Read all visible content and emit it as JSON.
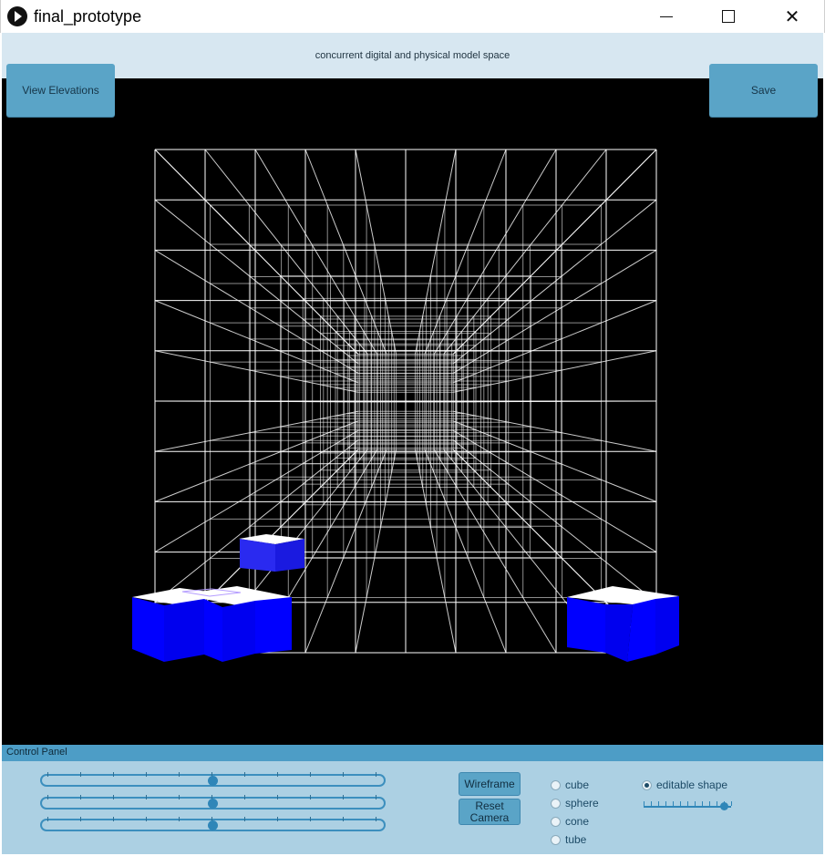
{
  "window": {
    "title": "final_prototype",
    "close_glyph": "✕"
  },
  "header": {
    "subtitle": "concurrent digital and physical model space"
  },
  "toolbar": {
    "view_elevations_label": "View Elevations",
    "save_label": "Save"
  },
  "control_panel": {
    "title": "Control Panel",
    "sliders": [
      {
        "value": 0.5
      },
      {
        "value": 0.5
      },
      {
        "value": 0.5
      }
    ],
    "wireframe_label": "Wireframe",
    "reset_camera_label": "Reset Camera",
    "shape_options": [
      "cube",
      "sphere",
      "cone",
      "tube"
    ],
    "selected_shape": "",
    "editable_shape_label": "editable shape",
    "editable_shape_checked": true,
    "editable_slider_value": 0.96
  },
  "colors": {
    "accent": "#5aa4c7",
    "panel": "#acd0e3",
    "header_band": "#d7e7f1",
    "cube_blue": "#0000ff"
  }
}
